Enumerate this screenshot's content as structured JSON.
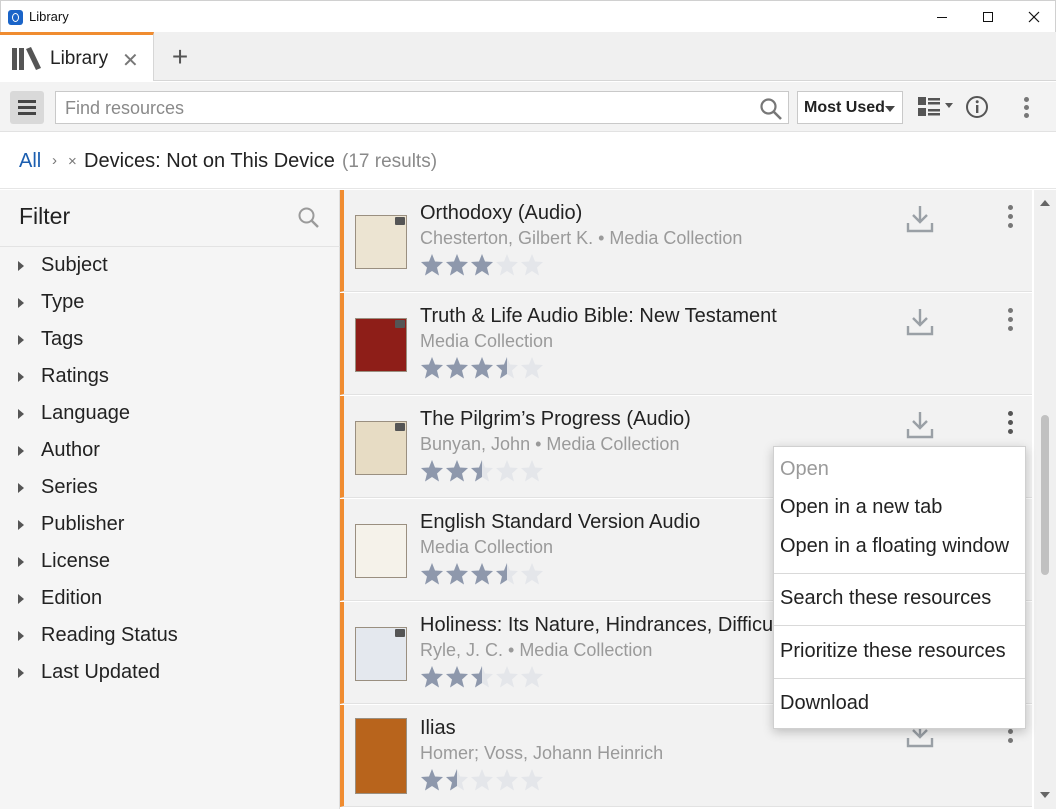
{
  "window": {
    "title": "Library",
    "controls": {
      "minimize": "minimize",
      "maximize": "maximize",
      "close": "close"
    }
  },
  "tabs": [
    {
      "label": "Library",
      "active": true
    }
  ],
  "tab_close_glyph": "✕",
  "tab_add_glyph": "+",
  "toolbar": {
    "search_placeholder": "Find resources",
    "sort_value": "Most Used"
  },
  "breadcrumb": {
    "root": "All",
    "separator": "›",
    "remove_glyph": "×",
    "filter": "Devices: Not on This Device",
    "count": "(17 results)"
  },
  "filter": {
    "title": "Filter",
    "items": [
      "Subject",
      "Type",
      "Tags",
      "Ratings",
      "Language",
      "Author",
      "Series",
      "Publisher",
      "License",
      "Edition",
      "Reading Status",
      "Last Updated"
    ]
  },
  "results": [
    {
      "title": "Orthodoxy (Audio)",
      "subtitle": "Chesterton, Gilbert K. • Media Collection",
      "rating": 3,
      "cover_color": "#ece4d2"
    },
    {
      "title": "Truth & Life Audio Bible: New Testament",
      "subtitle": "Media Collection",
      "rating": 3.5,
      "cover_color": "#8e1e18"
    },
    {
      "title": "The Pilgrim’s Progress (Audio)",
      "subtitle": "Bunyan, John • Media Collection",
      "rating": 2.5,
      "cover_color": "#e7dcc4"
    },
    {
      "title": "English Standard Version Audio",
      "subtitle": "Media Collection",
      "rating": 3.5,
      "cover_color": "#f5f2ea"
    },
    {
      "title": "Holiness: Its Nature, Hindrances, Difficulties, and Roots",
      "subtitle": "Ryle, J. C. • Media Collection",
      "rating": 2.5,
      "cover_color": "#e4e8ee"
    },
    {
      "title": "Ilias",
      "subtitle": "Homer; Voss, Johann Heinrich",
      "rating": 1.5,
      "cover_color": "#b8641c"
    }
  ],
  "context_menu": {
    "items": [
      {
        "label": "Open",
        "disabled": true
      },
      {
        "label": "Open in a new tab",
        "disabled": false
      },
      {
        "label": "Open in a floating window",
        "disabled": false
      },
      {
        "label": "Search these resources",
        "disabled": false
      },
      {
        "label": "Prioritize these resources",
        "disabled": false
      },
      {
        "label": "Download",
        "disabled": false
      }
    ]
  },
  "colors": {
    "accent": "#f08c30",
    "link": "#1b5eb0",
    "star_filled": "#8e98ac",
    "star_empty": "#e4e6ea"
  }
}
